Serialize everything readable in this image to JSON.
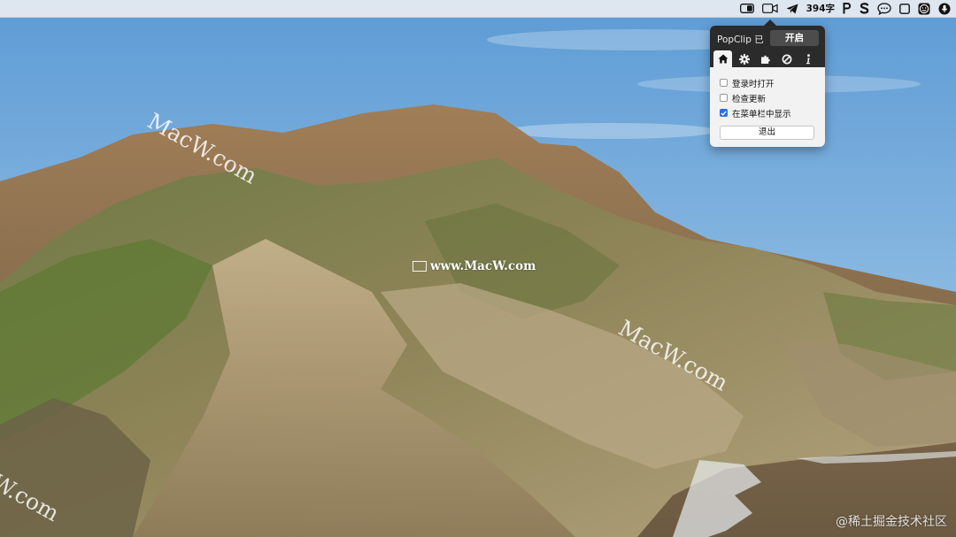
{
  "menubar": {
    "word_count": "394字",
    "tray_icons": [
      "popclip-icon",
      "video-icon",
      "telegram-icon",
      "word-count",
      "p-icon",
      "s-icon",
      "chat-icon",
      "square-icon",
      "emoji-icon",
      "microphone-icon"
    ]
  },
  "popclip": {
    "title": "PopClip 已",
    "toggle_label": "开启",
    "tabs": [
      "home-icon",
      "gear-icon",
      "puzzle-icon",
      "block-icon",
      "info-icon"
    ],
    "active_tab": "home-icon",
    "options": [
      {
        "label": "登录时打开",
        "checked": false
      },
      {
        "label": "检查更新",
        "checked": false
      },
      {
        "label": "在菜单栏中显示",
        "checked": true
      }
    ],
    "quit_label": "退出"
  },
  "watermarks": {
    "diagonal": "MacW.com",
    "diagonal_partial": "W.com",
    "center": "www.MacW.com",
    "source_credit": "@稀土掘金技术社区"
  },
  "colors": {
    "accent": "#2e6fe0",
    "popover_dark": "#2b2b2b",
    "sky": "#6fa7d8"
  }
}
